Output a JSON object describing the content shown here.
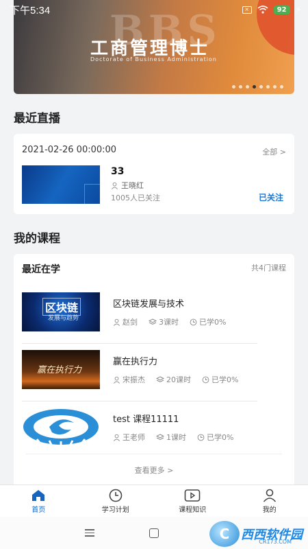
{
  "status_bar": {
    "time": "下午5:34",
    "battery": "92"
  },
  "banner": {
    "watermark_text": "BBS",
    "title": "工商管理博士",
    "subtitle": "Doctorate of Business Administration"
  },
  "live": {
    "section_title": "最近直播",
    "date": "2021-02-26 00:00:00",
    "all_link": "全部 >",
    "title": "33",
    "host": "王晓红",
    "followers": "1005人已关注",
    "follow_status": "已关注"
  },
  "courses": {
    "section_title": "我的课程",
    "card_title": "最近在学",
    "count": "共4门课程",
    "items": [
      {
        "thumb_text": "区块链",
        "thumb_sub": "发展与趋势",
        "name": "区块链发展与技术",
        "teacher": "赵剑",
        "lessons": "3课时",
        "progress": "已学0%"
      },
      {
        "thumb_text": "赢在执行力",
        "name": "赢在执行力",
        "teacher": "宋振杰",
        "lessons": "20课时",
        "progress": "已学0%"
      },
      {
        "name": "test 课程11111",
        "teacher": "王老师",
        "lessons": "1课时",
        "progress": "已学0%"
      }
    ],
    "more": "查看更多 >"
  },
  "tabs": [
    {
      "label": "首页",
      "icon": "home-icon",
      "active": true
    },
    {
      "label": "学习计划",
      "icon": "clock-icon"
    },
    {
      "label": "课程知识",
      "icon": "play-icon"
    },
    {
      "label": "我的",
      "icon": "user-icon"
    }
  ],
  "watermark": {
    "text": "西西软件园",
    "sub": "CR173.COM"
  },
  "colors": {
    "accent": "#1565c0",
    "follow": "#1976d2"
  }
}
